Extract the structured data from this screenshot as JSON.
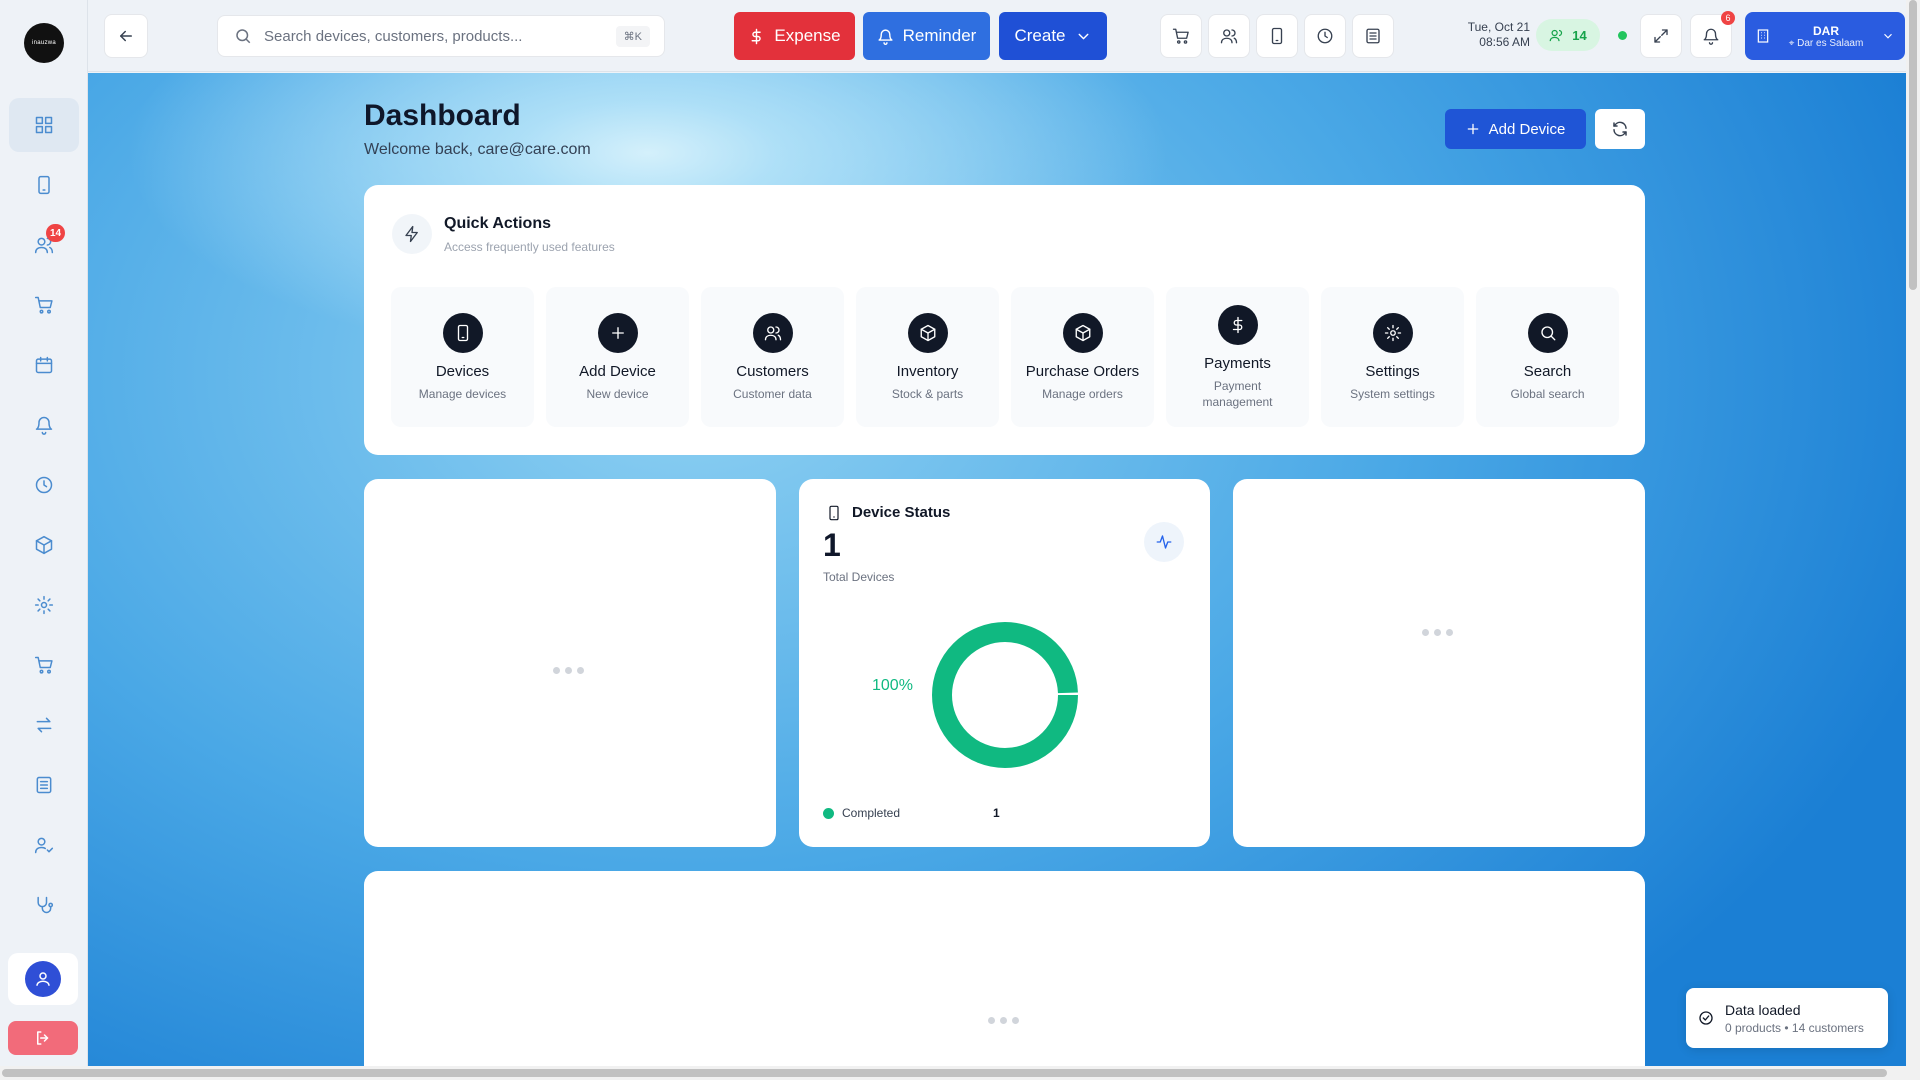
{
  "brand": {
    "logo_text": "inauzwa"
  },
  "sidebar": {
    "items": [
      {
        "icon": "dashboard-icon",
        "active": true
      },
      {
        "icon": "phone-icon"
      },
      {
        "icon": "users-icon",
        "badge": "14"
      },
      {
        "icon": "cart-icon"
      },
      {
        "icon": "calendar-icon"
      },
      {
        "icon": "bell-icon"
      },
      {
        "icon": "clock-icon"
      },
      {
        "icon": "box-icon"
      },
      {
        "icon": "gear-icon"
      },
      {
        "icon": "cart-icon"
      },
      {
        "icon": "transfer-icon"
      },
      {
        "icon": "register-icon"
      },
      {
        "icon": "user-check-icon"
      },
      {
        "icon": "stethoscope-icon"
      }
    ]
  },
  "topbar": {
    "search_placeholder": "Search devices, customers, products...",
    "search_shortcut": "⌘K",
    "expense_label": "Expense",
    "reminder_label": "Reminder",
    "create_label": "Create",
    "date": "Tue, Oct 21",
    "time": "08:56 AM",
    "online_count": "14",
    "notification_count": "6",
    "branch_name": "DAR",
    "branch_city": "Dar es Salaam"
  },
  "page": {
    "title": "Dashboard",
    "subtitle": "Welcome back, care@care.com",
    "add_device_label": "Add Device"
  },
  "quick_actions": {
    "title": "Quick Actions",
    "subtitle": "Access frequently used features",
    "items": [
      {
        "title": "Devices",
        "sub": "Manage devices",
        "icon": "phone-icon"
      },
      {
        "title": "Add Device",
        "sub": "New device",
        "icon": "plus-icon"
      },
      {
        "title": "Customers",
        "sub": "Customer data",
        "icon": "users-icon"
      },
      {
        "title": "Inventory",
        "sub": "Stock & parts",
        "icon": "box-icon"
      },
      {
        "title": "Purchase Orders",
        "sub": "Manage orders",
        "icon": "box-icon"
      },
      {
        "title": "Payments",
        "sub": "Payment management",
        "icon": "dollar-icon"
      },
      {
        "title": "Settings",
        "sub": "System settings",
        "icon": "gear-icon"
      },
      {
        "title": "Search",
        "sub": "Global search",
        "icon": "search-icon"
      }
    ]
  },
  "device_status": {
    "title": "Device Status",
    "total": "1",
    "total_label": "Total Devices",
    "percent_label": "100%",
    "legend": [
      {
        "name": "Completed",
        "value": "1"
      }
    ]
  },
  "chart_data": {
    "type": "pie",
    "categories": [
      "Completed"
    ],
    "values": [
      1
    ],
    "colors": [
      "#10b981"
    ]
  },
  "toast": {
    "title": "Data loaded",
    "message": "0 products • 14 customers"
  }
}
